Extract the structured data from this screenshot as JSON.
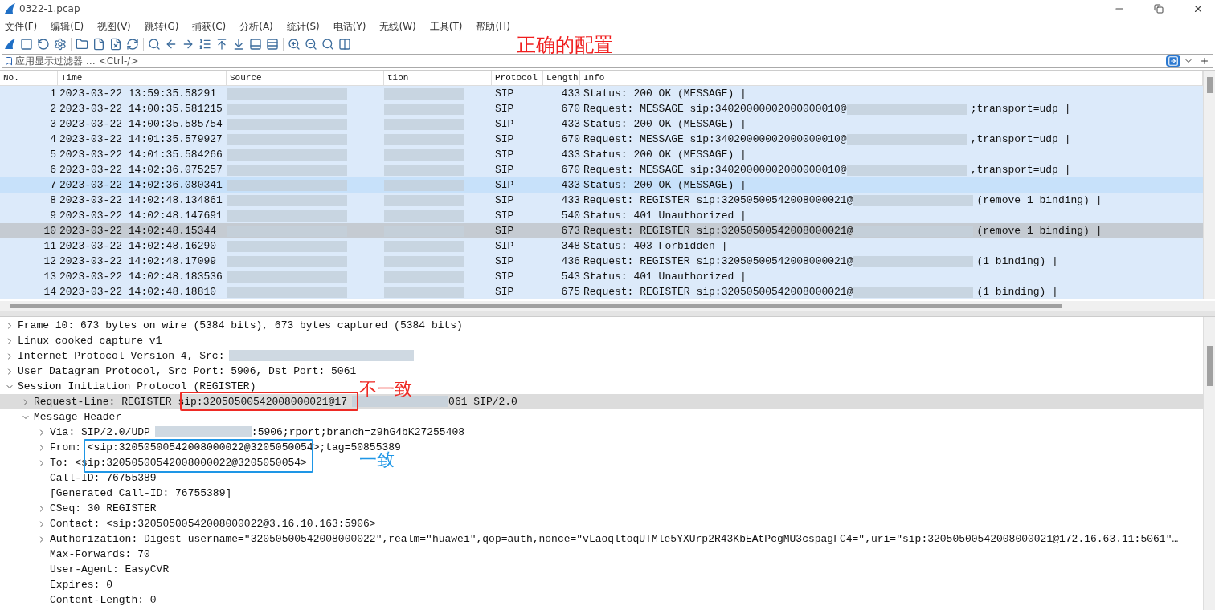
{
  "window": {
    "title": "0322-1.pcap"
  },
  "menu": [
    "文件(F)",
    "编辑(E)",
    "视图(V)",
    "跳转(G)",
    "捕获(C)",
    "分析(A)",
    "统计(S)",
    "电话(Y)",
    "无线(W)",
    "工具(T)",
    "帮助(H)"
  ],
  "filter": {
    "placeholder": "应用显示过滤器 … <Ctrl-/>"
  },
  "columns": [
    "No.",
    "Time",
    "Source",
    "tion",
    "Protocol",
    "Length",
    "Info"
  ],
  "rows": [
    {
      "no": "1",
      "time": "2023-03-22 13:59:35.58291",
      "protocol": "SIP",
      "length": "433",
      "info": "Status: 200 OK (MESSAGE) |",
      "selected": false,
      "hovered": false
    },
    {
      "no": "2",
      "time": "2023-03-22 14:00:35.581215",
      "protocol": "SIP",
      "length": "670",
      "info": "Request: MESSAGE sip:34020000002000000010@",
      "info_after": ";transport=udp |",
      "selected": false,
      "hovered": false
    },
    {
      "no": "3",
      "time": "2023-03-22 14:00:35.585754",
      "protocol": "SIP",
      "length": "433",
      "info": "Status: 200 OK (MESSAGE) |",
      "selected": false,
      "hovered": false
    },
    {
      "no": "4",
      "time": "2023-03-22 14:01:35.579927",
      "protocol": "SIP",
      "length": "670",
      "info": "Request: MESSAGE sip:34020000002000000010@",
      "info_after": ",transport=udp |",
      "selected": false,
      "hovered": false
    },
    {
      "no": "5",
      "time": "2023-03-22 14:01:35.584266",
      "protocol": "SIP",
      "length": "433",
      "info": "Status: 200 OK (MESSAGE) |",
      "selected": false,
      "hovered": false
    },
    {
      "no": "6",
      "time": "2023-03-22 14:02:36.075257",
      "protocol": "SIP",
      "length": "670",
      "info": "Request: MESSAGE sip:34020000002000000010@",
      "info_after": ",transport=udp |",
      "selected": false,
      "hovered": false
    },
    {
      "no": "7",
      "time": "2023-03-22 14:02:36.080341",
      "protocol": "SIP",
      "length": "433",
      "info": "Status: 200 OK (MESSAGE) |",
      "selected": false,
      "hovered": true
    },
    {
      "no": "8",
      "time": "2023-03-22 14:02:48.134861",
      "protocol": "SIP",
      "length": "433",
      "info": "Request: REGISTER sip:32050500542008000021@",
      "info_after": "(remove 1 binding) |",
      "selected": false,
      "hovered": false
    },
    {
      "no": "9",
      "time": "2023-03-22 14:02:48.147691",
      "protocol": "SIP",
      "length": "540",
      "info": "Status: 401 Unauthorized |",
      "selected": false,
      "hovered": false
    },
    {
      "no": "10",
      "time": "2023-03-22 14:02:48.15344",
      "protocol": "SIP",
      "length": "673",
      "info": "Request: REGISTER sip:32050500542008000021@",
      "info_after": "(remove 1 binding) |",
      "selected": true,
      "hovered": false
    },
    {
      "no": "11",
      "time": "2023-03-22 14:02:48.16290",
      "protocol": "SIP",
      "length": "348",
      "info": "Status: 403 Forbidden |",
      "selected": false,
      "hovered": false
    },
    {
      "no": "12",
      "time": "2023-03-22 14:02:48.17099",
      "protocol": "SIP",
      "length": "436",
      "info": "Request: REGISTER sip:32050500542008000021@",
      "info_after": "(1 binding) |",
      "selected": false,
      "hovered": false
    },
    {
      "no": "13",
      "time": "2023-03-22 14:02:48.183536",
      "protocol": "SIP",
      "length": "543",
      "info": "Status: 401 Unauthorized |",
      "selected": false,
      "hovered": false
    },
    {
      "no": "14",
      "time": "2023-03-22 14:02:48.18810",
      "protocol": "SIP",
      "length": "675",
      "info": "Request: REGISTER sip:32050500542008000021@",
      "info_after": "(1 binding) |",
      "selected": false,
      "hovered": false
    }
  ],
  "details": [
    {
      "kind": "branch",
      "text": "Frame 10: 673 bytes on wire (5384 bits), 673 bytes captured (5384 bits)",
      "expanded": false,
      "selected": false
    },
    {
      "kind": "branch",
      "text": "Linux cooked capture v1",
      "expanded": false,
      "selected": false
    },
    {
      "kind": "branch",
      "text": "Internet Protocol Version 4, Src:",
      "redacted": true,
      "expanded": false,
      "selected": false
    },
    {
      "kind": "branch",
      "text": "User Datagram Protocol, Src Port: 5906, Dst Port: 5061",
      "expanded": false,
      "selected": false
    },
    {
      "kind": "branch",
      "text": "Session Initiation Protocol (REGISTER)",
      "expanded": true,
      "selected": false,
      "children": [
        {
          "kind": "branch",
          "text": "Request-Line: REGISTER sip:32050500542008000021@17",
          "redacted": true,
          "text_after": "061 SIP/2.0",
          "expanded": false,
          "selected": true
        },
        {
          "kind": "branch",
          "text": "Message Header",
          "expanded": true,
          "selected": false,
          "children": [
            {
              "kind": "branch",
              "text": "Via: SIP/2.0/UDP",
              "redacted": true,
              "text_after": ":5906;rport;branch=z9hG4bK27255408",
              "expanded": false,
              "selected": false
            },
            {
              "kind": "branch",
              "text": "From: <sip:32050500542008000022@3205050054>;tag=50855389",
              "expanded": false,
              "selected": false
            },
            {
              "kind": "branch",
              "text": "To: <sip:32050500542008000022@3205050054>",
              "expanded": false,
              "selected": false
            },
            {
              "kind": "leaf",
              "text": "Call-ID: 76755389",
              "selected": false
            },
            {
              "kind": "leaf",
              "text": "[Generated Call-ID: 76755389]",
              "selected": false
            },
            {
              "kind": "branch",
              "text": "CSeq: 30 REGISTER",
              "expanded": false,
              "selected": false
            },
            {
              "kind": "branch",
              "text": "Contact: <sip:32050500542008000022@3.16.10.163:5906>",
              "expanded": false,
              "selected": false
            },
            {
              "kind": "branch",
              "text": "Authorization: Digest username=\"32050500542008000022\",realm=\"huawei\",qop=auth,nonce=\"vLaoqltoqUTMle5YXUrp2R43KbEAtPcgMU3cspagFC4=\",uri=\"sip:32050500542008000021@172.16.63.11:5061\"…",
              "expanded": false,
              "selected": false
            },
            {
              "kind": "leaf",
              "text": "Max-Forwards: 70",
              "selected": false
            },
            {
              "kind": "leaf",
              "text": "User-Agent: EasyCVR",
              "selected": false
            },
            {
              "kind": "leaf",
              "text": "Expires: 0",
              "selected": false
            },
            {
              "kind": "leaf",
              "text": "Content-Length: 0",
              "selected": false
            }
          ]
        }
      ]
    }
  ],
  "annotations": [
    {
      "kind": "label",
      "text": "正确的配置",
      "color": "#f01e1e"
    },
    {
      "kind": "box",
      "color": "#ee2a24"
    },
    {
      "kind": "label",
      "text": "不一致",
      "color": "#ee2a24"
    },
    {
      "kind": "box",
      "color": "#1e96e6"
    },
    {
      "kind": "label",
      "text": "一致",
      "color": "#1e96e6"
    }
  ]
}
